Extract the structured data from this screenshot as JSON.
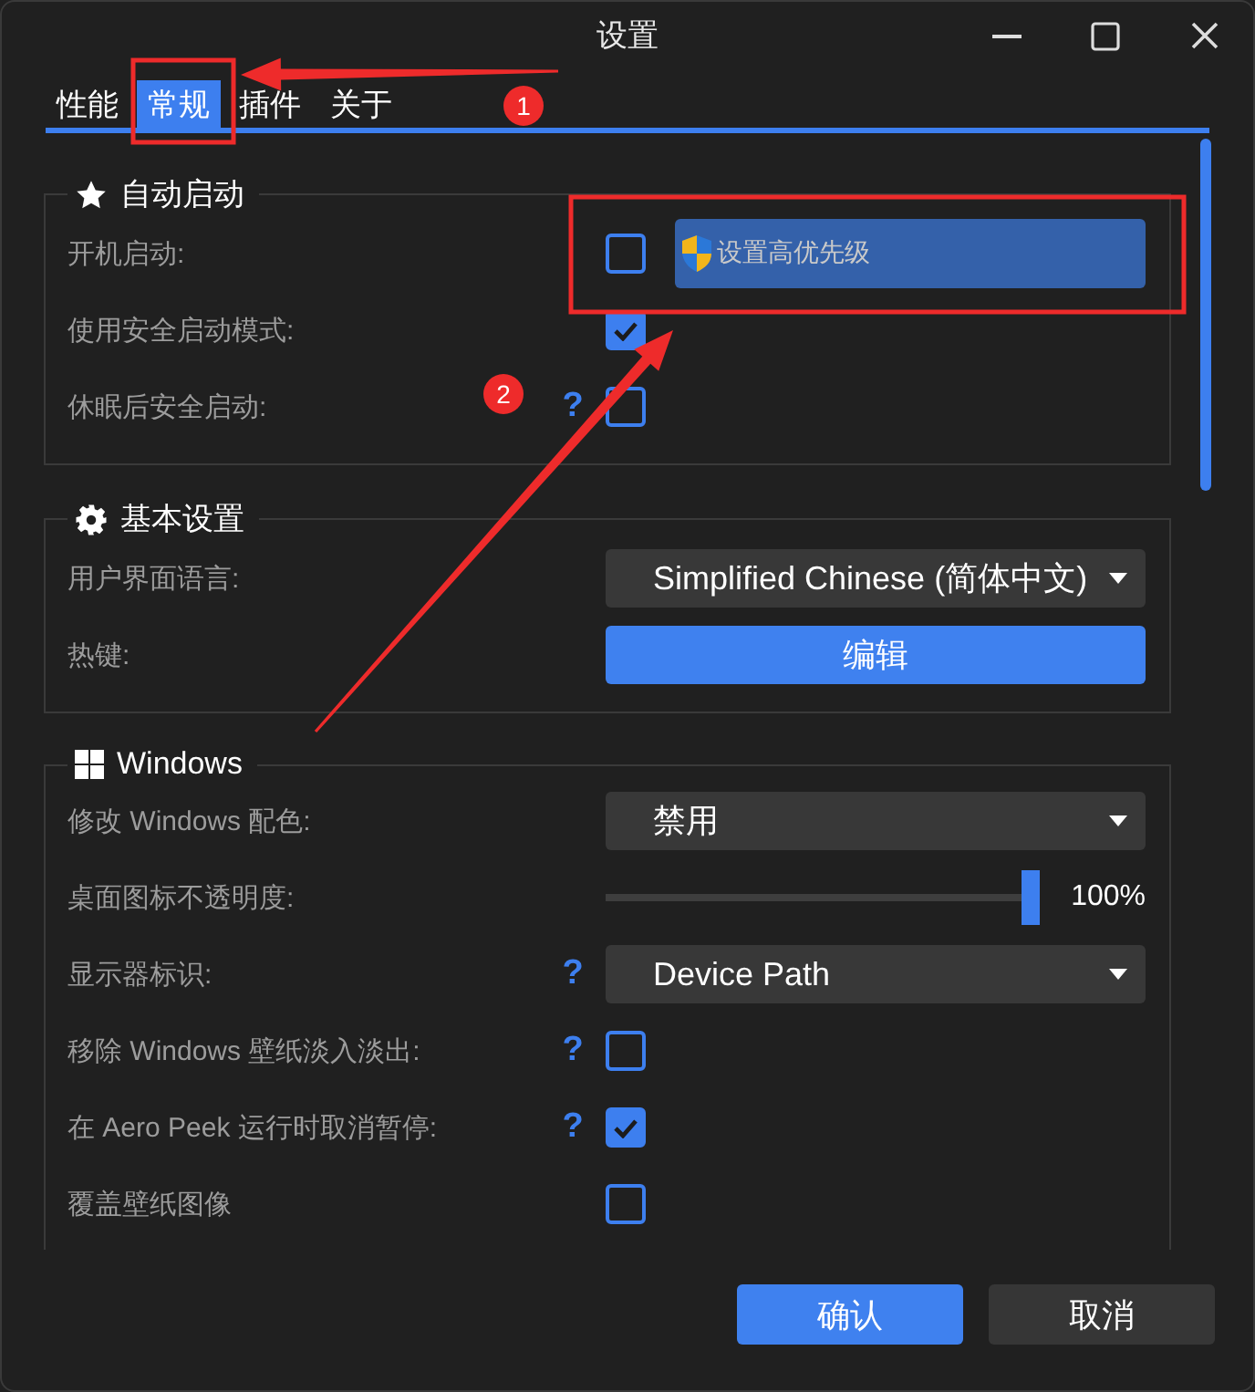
{
  "window": {
    "title": "设置"
  },
  "tabs": [
    {
      "label": "性能",
      "selected": false
    },
    {
      "label": "常规",
      "selected": true
    },
    {
      "label": "插件",
      "selected": false
    },
    {
      "label": "关于",
      "selected": false
    }
  ],
  "sections": [
    {
      "title": "自动启动",
      "rows": [
        {
          "kind": "checkbox",
          "label": "开机启动:",
          "checked": false,
          "button": "设置高优先级"
        },
        {
          "kind": "checkbox",
          "label": "使用安全启动模式:",
          "checked": true
        },
        {
          "kind": "checkbox",
          "label": "休眠后安全启动:",
          "help": "?",
          "checked": false
        }
      ]
    },
    {
      "title": "基本设置",
      "rows": [
        {
          "kind": "dropdown",
          "label": "用户界面语言:",
          "value": "Simplified Chinese (简体中文)"
        },
        {
          "kind": "button",
          "label": "热键:",
          "button": "编辑"
        }
      ]
    },
    {
      "title": "Windows",
      "rows": [
        {
          "kind": "dropdown",
          "label": "修改 Windows 配色:",
          "value": "禁用"
        },
        {
          "kind": "slider",
          "label": "桌面图标不透明度:",
          "level": 1,
          "reading": "100%"
        },
        {
          "kind": "dropdown",
          "label": "显示器标识:",
          "help": "?",
          "value": "Device Path"
        },
        {
          "kind": "checkbox",
          "label": "移除 Windows 壁纸淡入淡出:",
          "help": "?",
          "checked": false
        },
        {
          "kind": "checkbox",
          "label": "在 Aero Peek 运行时取消暂停:",
          "help": "?",
          "checked": true
        },
        {
          "kind": "checkbox",
          "label": "覆盖壁纸图像",
          "checked": false
        }
      ]
    }
  ],
  "buttons": [
    {
      "label": "确认",
      "primary": true
    },
    {
      "label": "取消",
      "primary": false
    }
  ],
  "annotations": [
    {
      "label": "1"
    },
    {
      "label": "2"
    }
  ]
}
